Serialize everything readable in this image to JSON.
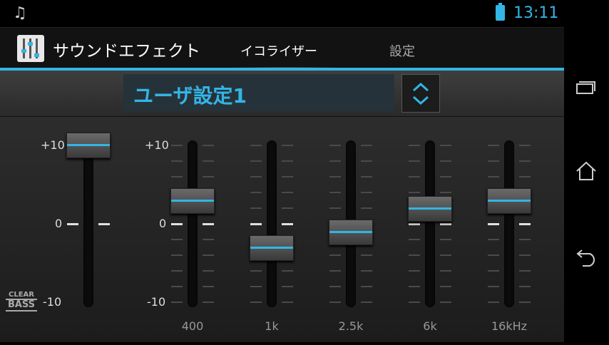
{
  "status_bar": {
    "time": "13:11",
    "notification_icon": "music-note-icon"
  },
  "app_bar": {
    "title": "サウンドエフェクト",
    "tabs": [
      "イコライザー",
      "設定"
    ]
  },
  "preset": {
    "name": "ユーザ設定1"
  },
  "equalizer": {
    "scale_labels": {
      "top": "+10",
      "mid": "0",
      "bottom": "-10"
    },
    "clear_bass": {
      "top": "CLEAR",
      "bottom": "BASS",
      "level": 10
    },
    "bands": [
      {
        "label": "400",
        "level": 3
      },
      {
        "label": "1k",
        "level": -3
      },
      {
        "label": "2.5k",
        "level": -1
      },
      {
        "label": "6k",
        "level": 2
      },
      {
        "label": "16kHz",
        "level": 3
      }
    ]
  },
  "colors": {
    "accent": "#33b5e5"
  }
}
